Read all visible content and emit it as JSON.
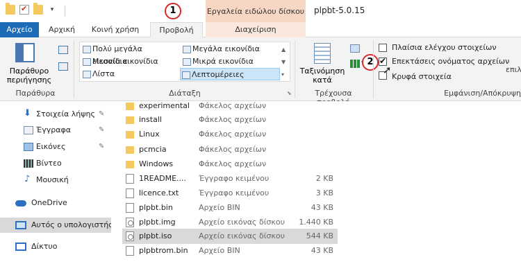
{
  "window": {
    "title": "plpbt-5.0.15",
    "contextual_tab_header": "Εργαλεία ειδώλου δίσκου"
  },
  "callouts": [
    "1",
    "2"
  ],
  "tabs": [
    {
      "label": "Αρχείο"
    },
    {
      "label": "Αρχική"
    },
    {
      "label": "Κοινή χρήση"
    },
    {
      "label": "Προβολή"
    },
    {
      "label": "Διαχείριση"
    }
  ],
  "ribbon": {
    "panes": {
      "button": "Παράθυρο περιήγησης",
      "group": "Παράθυρα"
    },
    "layout": {
      "group": "Διάταξη",
      "options": [
        "Πολύ μεγάλα εικονίδια",
        "Μεγάλα εικονίδια",
        "Μεσαία εικονίδια",
        "Μικρά εικονίδια",
        "Λίστα",
        "Λεπτομέρειες"
      ],
      "selected": "Λεπτομέρειες"
    },
    "current_view": {
      "sort_button": "Ταξινόμηση κατά",
      "group": "Τρέχουσα προβολή"
    },
    "show_hide": {
      "group": "Εμφάνιση/Απόκρυψη",
      "checkboxes": [
        {
          "label": "Πλαίσια ελέγχου στοιχείων",
          "checked": false
        },
        {
          "label": "Επεκτάσεις ονόματος αρχείων",
          "checked": true
        },
        {
          "label": "Κρυφά στοιχεία",
          "checked": false
        }
      ],
      "truncated_label": "επιλ"
    }
  },
  "nav": {
    "items": [
      {
        "label": "Στοιχεία λήψης",
        "icon": "download-icon",
        "pinned": true
      },
      {
        "label": "Έγγραφα",
        "icon": "documents-icon",
        "pinned": true
      },
      {
        "label": "Εικόνες",
        "icon": "pictures-icon",
        "pinned": true
      },
      {
        "label": "Βίντεο",
        "icon": "video-icon",
        "pinned": false
      },
      {
        "label": "Μουσική",
        "icon": "music-icon",
        "pinned": false
      },
      {
        "label": "OneDrive",
        "icon": "onedrive-icon",
        "pinned": false
      },
      {
        "label": "Αυτός ο υπολογιστής",
        "icon": "computer-icon",
        "pinned": false
      },
      {
        "label": "Δίκτυο",
        "icon": "network-icon",
        "pinned": false
      }
    ],
    "pin_glyph": "📌"
  },
  "files": [
    {
      "name": "experimental",
      "type": "Φάκελος αρχείων",
      "size": "",
      "icon": "folder"
    },
    {
      "name": "install",
      "type": "Φάκελος αρχείων",
      "size": "",
      "icon": "folder"
    },
    {
      "name": "Linux",
      "type": "Φάκελος αρχείων",
      "size": "",
      "icon": "folder"
    },
    {
      "name": "pcmcia",
      "type": "Φάκελος αρχείων",
      "size": "",
      "icon": "folder"
    },
    {
      "name": "Windows",
      "type": "Φάκελος αρχείων",
      "size": "",
      "icon": "folder"
    },
    {
      "name": "1README....",
      "type": "Έγγραφο κειμένου",
      "size": "2 KB",
      "icon": "file"
    },
    {
      "name": "licence.txt",
      "type": "Έγγραφο κειμένου",
      "size": "3 KB",
      "icon": "file"
    },
    {
      "name": "plpbt.bin",
      "type": "Αρχείο BIN",
      "size": "43 KB",
      "icon": "file"
    },
    {
      "name": "plpbt.img",
      "type": "Αρχείο εικόνας δίσκου",
      "size": "1.440 KB",
      "icon": "disc"
    },
    {
      "name": "plpbt.iso",
      "type": "Αρχείο εικόνας δίσκου",
      "size": "544 KB",
      "icon": "disc",
      "selected": true
    },
    {
      "name": "plpbtrom.bin",
      "type": "Αρχείο BIN",
      "size": "43 KB",
      "icon": "file"
    }
  ],
  "colors": {
    "file_tab": "#1e6bb8",
    "contextual": "#f7d7c4",
    "callout": "#d62a2a",
    "selection": "#d9d9d9"
  }
}
